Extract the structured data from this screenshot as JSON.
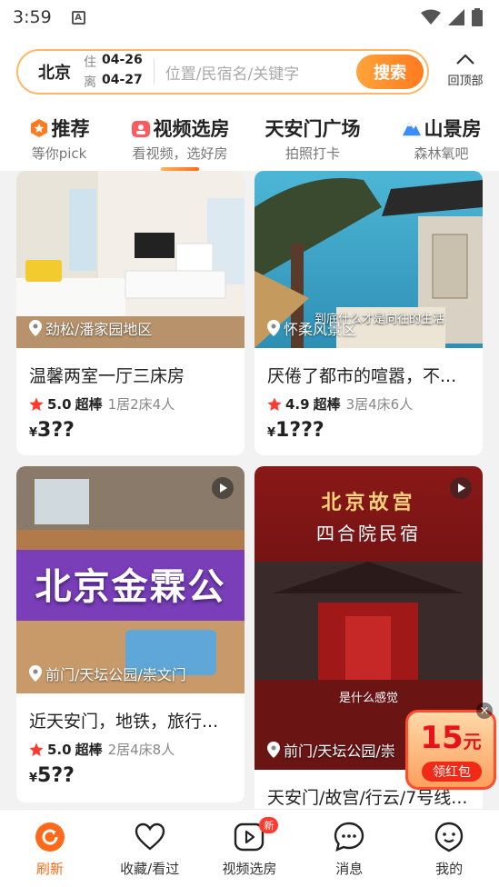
{
  "status": {
    "time": "3:59"
  },
  "search": {
    "city": "北京",
    "checkin_label": "住",
    "checkin_date": "04-26",
    "checkout_label": "离",
    "checkout_date": "04-27",
    "placeholder": "位置/民宿名/关键字",
    "button": "搜索",
    "back_top": "回顶部"
  },
  "tabs": [
    {
      "title": "推荐",
      "sub": "等你pick"
    },
    {
      "title": "视频选房",
      "sub": "看视频，选好房",
      "active": true
    },
    {
      "title": "天安门广场",
      "sub": "拍照打卡"
    },
    {
      "title": "山景房",
      "sub": "森林氧吧"
    }
  ],
  "cards": [
    {
      "location": "劲松/潘家园地区",
      "title": "温馨两室一厅三床房",
      "score": "5.0",
      "tag": "超棒",
      "rooms": "1居2床4人",
      "currency": "¥",
      "price": "3??"
    },
    {
      "location": "怀柔风景区",
      "overlay_text": "到底什么才是向往的生活",
      "title": "厌倦了都市的喧嚣，不...",
      "score": "4.9",
      "tag": "超棒",
      "rooms": "3居4床6人",
      "currency": "¥",
      "price": "1???"
    },
    {
      "location": "前门/天坛公园/崇文门",
      "overlay_text": "北京金霖公",
      "title": "近天安门，地铁，旅行...",
      "score": "5.0",
      "tag": "超棒",
      "rooms": "2居4床8人",
      "currency": "¥",
      "price": "5??"
    },
    {
      "location": "前门/天坛公园/崇",
      "overlay_title": "北京故宫",
      "overlay_sub": "四合院民宿",
      "overlay_text": "是什么感觉",
      "title": "天安门/故宫/行云/7号线..."
    }
  ],
  "redpack": {
    "amount": "15",
    "unit": "元",
    "button": "领红包"
  },
  "nav": [
    {
      "label": "刷新",
      "active": true
    },
    {
      "label": "收藏/看过"
    },
    {
      "label": "视频选房",
      "badge": "新"
    },
    {
      "label": "消息"
    },
    {
      "label": "我的"
    }
  ],
  "colors": {
    "accent": "#ff6a1a",
    "search_border": "#ffb766",
    "star": "#ff3b30"
  }
}
